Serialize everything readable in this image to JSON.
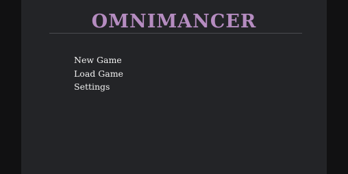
{
  "game_title": "OMNIMANCER",
  "menu": {
    "items": [
      {
        "label": "New Game"
      },
      {
        "label": "Load Game"
      },
      {
        "label": "Settings"
      }
    ]
  },
  "colors": {
    "background": "#111112",
    "panel": "#232427",
    "title": "#b58cc0",
    "divider": "#4a4b50",
    "menu_text": "#f2f2f2"
  }
}
